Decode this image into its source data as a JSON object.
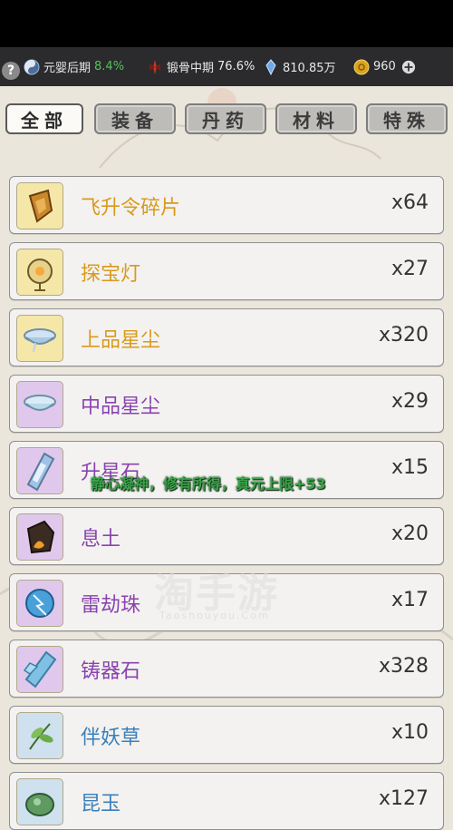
{
  "status_bar": {
    "help": "?",
    "realm_label": "元婴后期",
    "realm_pct": "8.4%",
    "body_label": "锻骨中期",
    "body_pct": "76.6%",
    "spirit_stones": "810.85万",
    "coins": "960"
  },
  "tabs": [
    {
      "label": "全部",
      "active": true
    },
    {
      "label": "装备",
      "active": false
    },
    {
      "label": "丹药",
      "active": false
    },
    {
      "label": "材料",
      "active": false
    },
    {
      "label": "特殊",
      "active": false
    }
  ],
  "items": [
    {
      "name": "飞升令碎片",
      "qty": "x64",
      "name_color": "#d89a1e",
      "box_color": "#f5e7a8",
      "icon": "token-shard-icon"
    },
    {
      "name": "探宝灯",
      "qty": "x27",
      "name_color": "#d89a1e",
      "box_color": "#f5e7a8",
      "icon": "treasure-lamp-icon"
    },
    {
      "name": "上品星尘",
      "qty": "x320",
      "name_color": "#d89a1e",
      "box_color": "#f5e7a8",
      "icon": "stardust-bowl-icon"
    },
    {
      "name": "中品星尘",
      "qty": "x29",
      "name_color": "#8a43b0",
      "box_color": "#e0c8ec",
      "icon": "stardust-bowl-icon"
    },
    {
      "name": "升星石",
      "qty": "x15",
      "name_color": "#8a43b0",
      "box_color": "#e0c8ec",
      "icon": "star-stone-icon"
    },
    {
      "name": "息土",
      "qty": "x20",
      "name_color": "#8a43b0",
      "box_color": "#e0c8ec",
      "icon": "earth-ore-icon"
    },
    {
      "name": "雷劫珠",
      "qty": "x17",
      "name_color": "#8a43b0",
      "box_color": "#e0c8ec",
      "icon": "thunder-orb-icon"
    },
    {
      "name": "铸器石",
      "qty": "x328",
      "name_color": "#8a43b0",
      "box_color": "#e0c8ec",
      "icon": "crystal-ore-icon"
    },
    {
      "name": "伴妖草",
      "qty": "x10",
      "name_color": "#3b7fb8",
      "box_color": "#cfe0ef",
      "icon": "herb-leaf-icon"
    },
    {
      "name": "昆玉",
      "qty": "x127",
      "name_color": "#3b7fb8",
      "box_color": "#cfe0ef",
      "icon": "jade-stone-icon"
    }
  ],
  "floating_message": "静心凝神，修有所得，真元上限+53",
  "watermark": {
    "main": "淘手游",
    "sub": "Taoshouyou.Com"
  }
}
